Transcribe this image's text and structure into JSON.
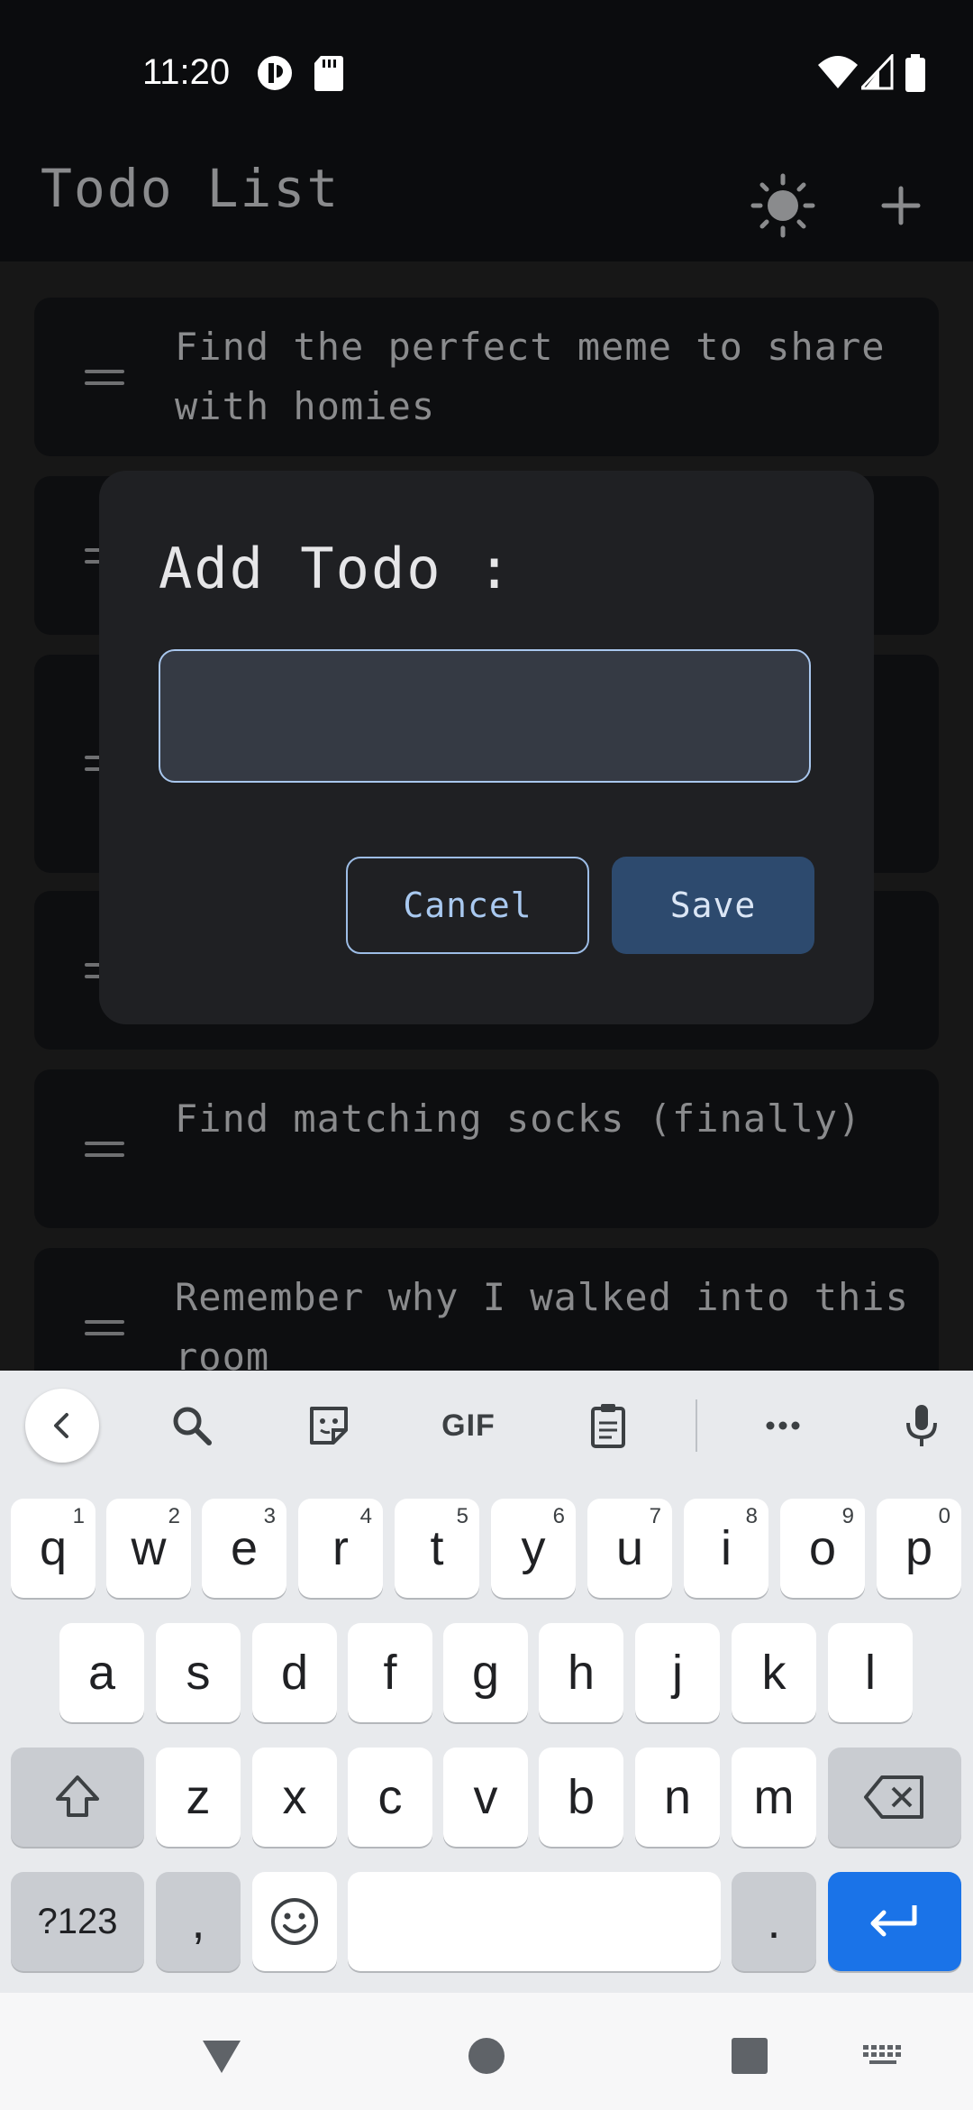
{
  "status_bar": {
    "time": "11:20"
  },
  "app_bar": {
    "title": "Todo List",
    "theme_icon": "sun-icon",
    "add_icon": "plus-icon"
  },
  "todos": [
    {
      "text": "Find the perfect meme to share with homies"
    },
    {
      "text": ""
    },
    {
      "text": ""
    },
    {
      "text": ""
    },
    {
      "text": "Find matching socks (finally)"
    },
    {
      "text": "Remember why I walked into this room"
    }
  ],
  "dialog": {
    "title": "Add Todo :",
    "input_value": "",
    "cancel_label": "Cancel",
    "save_label": "Save"
  },
  "keyboard": {
    "toolbar": [
      "back-icon",
      "search-icon",
      "sticker-icon",
      "GIF",
      "clipboard-icon",
      "more-icon",
      "mic-icon"
    ],
    "gif_label": "GIF",
    "row1": [
      {
        "k": "q",
        "h": "1"
      },
      {
        "k": "w",
        "h": "2"
      },
      {
        "k": "e",
        "h": "3"
      },
      {
        "k": "r",
        "h": "4"
      },
      {
        "k": "t",
        "h": "5"
      },
      {
        "k": "y",
        "h": "6"
      },
      {
        "k": "u",
        "h": "7"
      },
      {
        "k": "i",
        "h": "8"
      },
      {
        "k": "o",
        "h": "9"
      },
      {
        "k": "p",
        "h": "0"
      }
    ],
    "row2": [
      "a",
      "s",
      "d",
      "f",
      "g",
      "h",
      "j",
      "k",
      "l"
    ],
    "row3": [
      "z",
      "x",
      "c",
      "v",
      "b",
      "n",
      "m"
    ],
    "symbols_label": "?123",
    "comma_label": ",",
    "period_label": "."
  },
  "colors": {
    "background": "#171717",
    "card": "#0d0e10",
    "dialog": "#1f2023",
    "accent": "#2d4a6e",
    "enter_key": "#1a73e8"
  }
}
